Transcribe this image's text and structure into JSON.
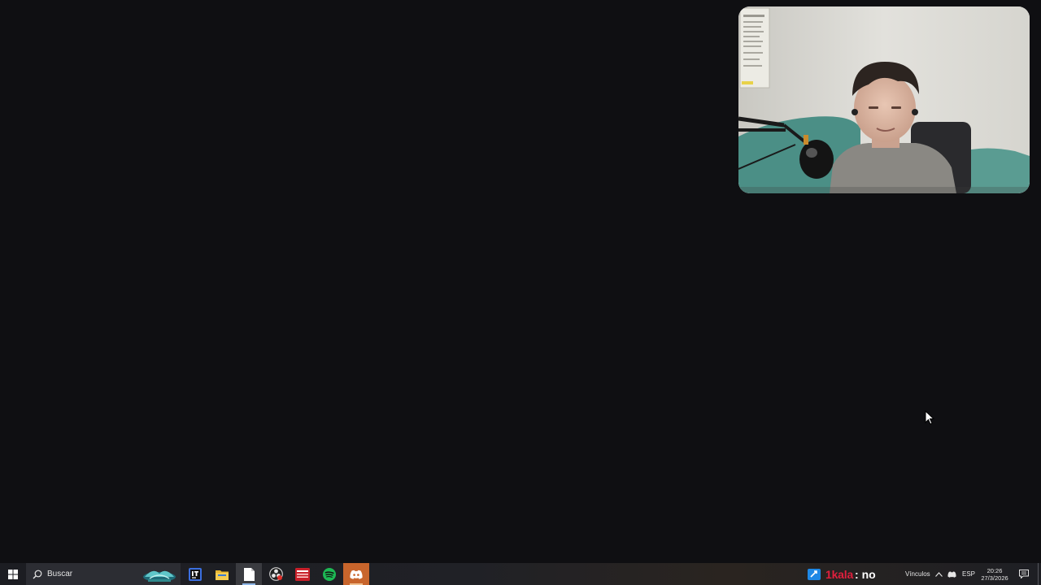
{
  "taskbar": {
    "search_placeholder": "Buscar",
    "apps": [
      {
        "icon": "intellij-icon"
      },
      {
        "icon": "file-explorer-icon"
      },
      {
        "icon": "notepad-icon"
      },
      {
        "icon": "obs-icon"
      },
      {
        "icon": "voicemeeter-icon"
      },
      {
        "icon": "spotify-icon"
      },
      {
        "icon": "discord-icon"
      }
    ],
    "stream_user": "1kala",
    "stream_message": ": no",
    "links_label": "Vínculos",
    "language": "ESP",
    "time": "20:26",
    "date": "27/3/2026"
  },
  "colors": {
    "desktop": "#0f0f12",
    "stream_user": "#e01f3d",
    "discord_highlight": "#c8652c",
    "spotify": "#1db954"
  }
}
